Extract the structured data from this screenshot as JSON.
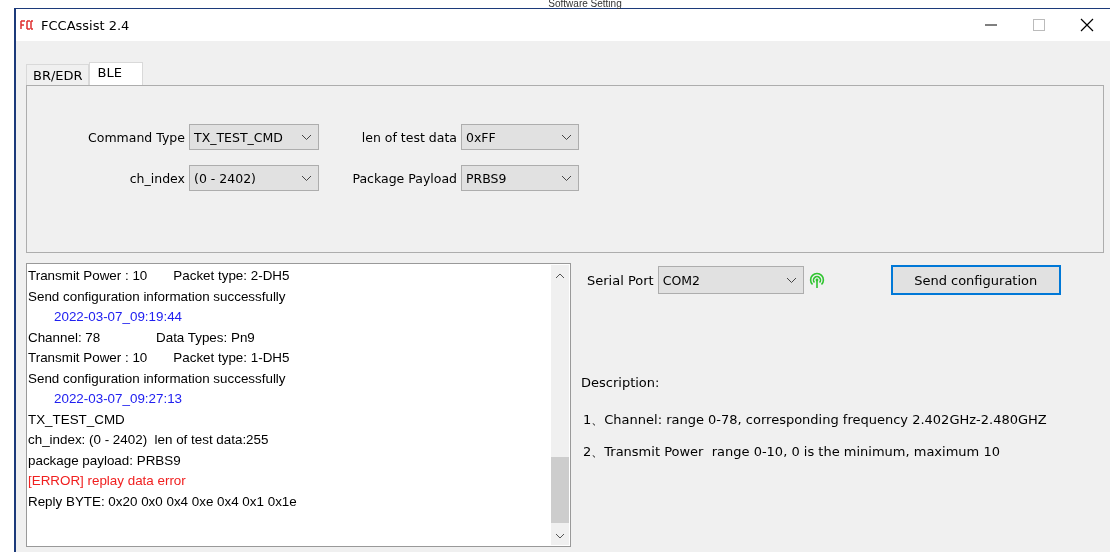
{
  "caption": "Software Setting",
  "window": {
    "title": "FCCAssist 2.4",
    "controls": [
      {
        "kind": "minimize"
      },
      {
        "kind": "maximize"
      },
      {
        "kind": "close"
      }
    ]
  },
  "tabs": [
    {
      "label": "BR/EDR",
      "selected": false
    },
    {
      "label": "BLE",
      "selected": true
    }
  ],
  "fields": [
    {
      "label": "Command Type",
      "value": "TX_TEST_CMD"
    },
    {
      "label": "len of test data",
      "value": "0xFF"
    },
    {
      "label": "ch_index",
      "value": "(0 - 2402)"
    },
    {
      "label": "Package Payload",
      "value": "PRBS9"
    }
  ],
  "log": [
    {
      "kind": "plain",
      "text": "Transmit Power : 10       Packet type: 2-DH5"
    },
    {
      "kind": "plain",
      "text": "Send configuration information successfully"
    },
    {
      "kind": "time",
      "text": "2022-03-07_09:19:44"
    },
    {
      "kind": "plain",
      "text": "Channel: 78               Data Types: Pn9"
    },
    {
      "kind": "plain",
      "text": "Transmit Power : 10       Packet type: 1-DH5"
    },
    {
      "kind": "plain",
      "text": "Send configuration information successfully"
    },
    {
      "kind": "time",
      "text": "2022-03-07_09:27:13"
    },
    {
      "kind": "plain",
      "text": "TX_TEST_CMD"
    },
    {
      "kind": "plain",
      "text": "ch_index: (0 - 2402)  len of test data:255"
    },
    {
      "kind": "plain",
      "text": "package payload: PRBS9"
    },
    {
      "kind": "error",
      "text": "[ERROR] replay data error"
    },
    {
      "kind": "plain",
      "text": "Reply BYTE: 0x20 0x0 0x4 0xe 0x4 0x1 0x1e"
    }
  ],
  "serial_port": {
    "label": "Serial Port",
    "value": "COM2",
    "connected": true
  },
  "send_button": "Send configuration",
  "description": {
    "title": "Description:",
    "items": [
      "1、Channel: range 0-78, corresponding frequency 2.402GHz-2.480GHZ",
      "2、Transmit Power  range 0-10, 0 is the minimum, maximum 10"
    ]
  }
}
